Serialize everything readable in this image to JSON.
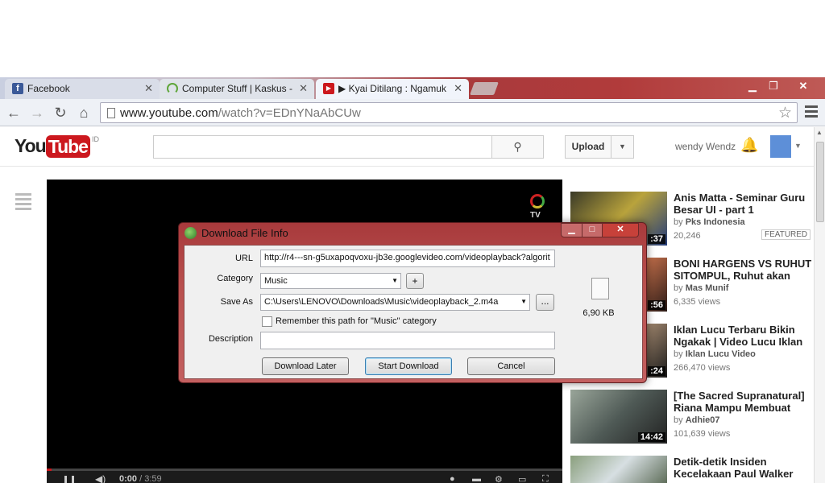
{
  "browser": {
    "tabs": [
      {
        "title": "Facebook",
        "icon": "facebook-icon",
        "color": "#3b5998"
      },
      {
        "title": "Computer Stuff | Kaskus -",
        "icon": "kaskus-spinner-icon",
        "color": "#5fa63a"
      },
      {
        "title": "▶ Kyai Ditilang : Ngamuk",
        "icon": "youtube-icon",
        "color": "#cc181e"
      }
    ],
    "url_host": "www.youtube.com",
    "url_path": "/watch?v=EDnYNaAbCUw"
  },
  "youtube": {
    "region": "ID",
    "search_placeholder": "",
    "upload_label": "Upload",
    "username": "wendy Wendz",
    "player": {
      "current_time": "0:00",
      "total_time": "/ 3:59",
      "progress_fraction": 0.01
    },
    "related": [
      {
        "title": "Anis Matta - Seminar Guru Besar UI - part 1",
        "by_prefix": "by",
        "channel": "Pks Indonesia",
        "views": "20,246",
        "duration": ":37",
        "badge": "FEATURED"
      },
      {
        "title": "BONI HARGENS VS RUHUT SITOMPUL, Ruhut akan",
        "by_prefix": "by",
        "channel": "Mas Munif",
        "views": "6,335 views",
        "duration": ":56",
        "badge": ""
      },
      {
        "title": "Iklan Lucu Terbaru Bikin Ngakak | Video Lucu Iklan",
        "by_prefix": "by",
        "channel": "Iklan Lucu Video",
        "views": "266,470 views",
        "duration": ":24",
        "badge": ""
      },
      {
        "title": "[The Sacred Supranatural] Riana Mampu Membuat",
        "by_prefix": "by",
        "channel": "Adhie07",
        "views": "101,639 views",
        "duration": "14:42",
        "badge": ""
      },
      {
        "title": "Detik-detik Insiden Kecelakaan Paul Walker",
        "by_prefix": "",
        "channel": "",
        "views": "",
        "duration": "",
        "badge": ""
      }
    ]
  },
  "dialog": {
    "title": "Download File Info",
    "url_label": "URL",
    "url_value": "http://r4---sn-g5uxapoqvoxu-jb3e.googlevideo.com/videoplayback?algorit",
    "category_label": "Category",
    "category_value": "Music",
    "add_category_label": "+",
    "save_as_label": "Save As",
    "save_as_value": "C:\\Users\\LENOVO\\Downloads\\Music\\videoplayback_2.m4a",
    "browse_label": "...",
    "remember_label": "Remember this path for \"Music\" category",
    "remember_checked": false,
    "description_label": "Description",
    "description_value": "",
    "download_later_label": "Download Later",
    "start_download_label": "Start Download",
    "cancel_label": "Cancel",
    "file_size": "6,90  KB"
  }
}
